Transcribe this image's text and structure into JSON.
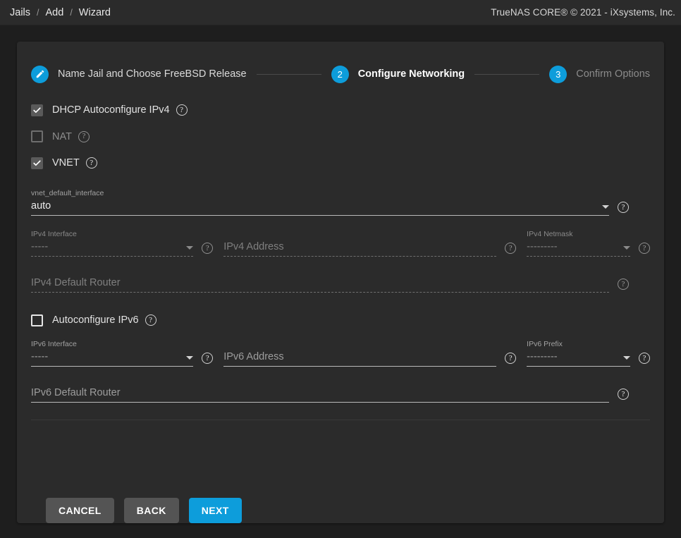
{
  "topbar": {
    "breadcrumb": [
      "Jails",
      "Add",
      "Wizard"
    ],
    "separator": "/",
    "copyright": "TrueNAS CORE® © 2021 - iXsystems, Inc."
  },
  "stepper": {
    "steps": [
      {
        "marker": "edit-icon",
        "label": "Name Jail and Choose FreeBSD Release",
        "state": "completed"
      },
      {
        "marker": "2",
        "label": "Configure Networking",
        "state": "active"
      },
      {
        "marker": "3",
        "label": "Confirm Options",
        "state": "upcoming"
      }
    ]
  },
  "form": {
    "checkboxes": [
      {
        "label": "DHCP Autoconfigure IPv4",
        "checked": true,
        "enabled": false,
        "help": "?"
      },
      {
        "label": "NAT",
        "checked": false,
        "enabled": false,
        "help": "?"
      },
      {
        "label": "VNET",
        "checked": true,
        "enabled": false,
        "help": "?"
      },
      {
        "label": "Autoconfigure IPv6",
        "checked": false,
        "enabled": true,
        "help": "?"
      }
    ],
    "vnet_default_interface": {
      "label": "vnet_default_interface",
      "value": "auto",
      "help": "?"
    },
    "ipv4_interface": {
      "label": "IPv4 Interface",
      "value": "-----",
      "help": "?"
    },
    "ipv4_address": {
      "placeholder": "IPv4 Address",
      "value": "",
      "help": "?"
    },
    "ipv4_netmask": {
      "label": "IPv4 Netmask",
      "value": "---------",
      "help": "?"
    },
    "ipv4_default_router": {
      "placeholder": "IPv4 Default Router",
      "value": "",
      "help": "?"
    },
    "ipv6_interface": {
      "label": "IPv6 Interface",
      "value": "-----",
      "help": "?"
    },
    "ipv6_address": {
      "placeholder": "IPv6 Address",
      "value": "",
      "help": "?"
    },
    "ipv6_prefix": {
      "label": "IPv6 Prefix",
      "value": "---------",
      "help": "?"
    },
    "ipv6_default_router": {
      "placeholder": "IPv6 Default Router",
      "value": "",
      "help": "?"
    }
  },
  "actions": {
    "cancel": "CANCEL",
    "back": "BACK",
    "next": "NEXT"
  },
  "colors": {
    "accent": "#0d9ddb",
    "page_bg": "#1e1e1e",
    "card_bg": "#2b2b2b",
    "button_grey": "#545454"
  }
}
